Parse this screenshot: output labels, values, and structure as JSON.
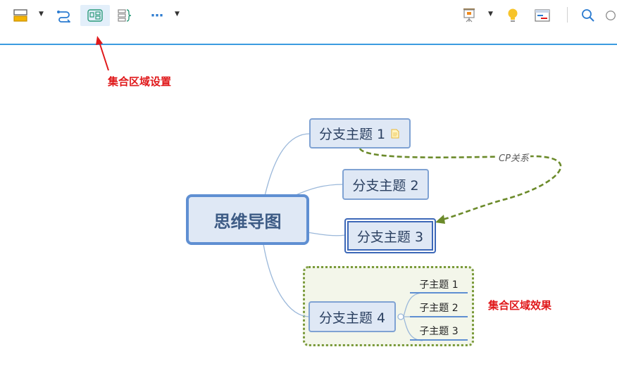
{
  "annotations": {
    "set_region_setting": "集合区域设置",
    "set_region_effect": "集合区域效果"
  },
  "mindmap": {
    "central": "思维导图",
    "branches": [
      {
        "label": "分支主题 1"
      },
      {
        "label": "分支主题 2"
      },
      {
        "label": "分支主题 3"
      },
      {
        "label": "分支主题 4"
      }
    ],
    "subtopics": [
      "子主题 1",
      "子主题 2",
      "子主题 3"
    ],
    "relationship_label": "CP关系"
  },
  "colors": {
    "accent_line": "#3b9be0",
    "annotation_red": "#e0191b",
    "relationship_green": "#6b8a2a",
    "topic_border": "#7fa2d3"
  }
}
